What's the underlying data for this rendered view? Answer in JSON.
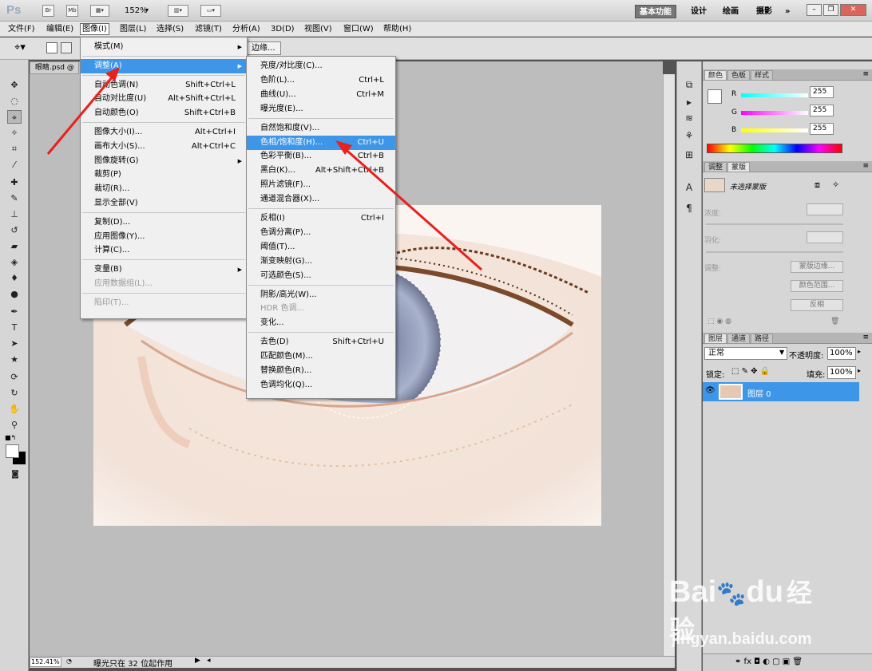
{
  "app": {
    "logo": "Ps",
    "zoom": "152%",
    "bridge": "Br",
    "mini_bridge": "Mb"
  },
  "workspaces": [
    "基本功能",
    "设计",
    "绘画",
    "摄影",
    "»"
  ],
  "menubar": [
    "文件(F)",
    "编辑(E)",
    "图像(I)",
    "图层(L)",
    "选择(S)",
    "滤镜(T)",
    "分析(A)",
    "3D(D)",
    "视图(V)",
    "窗口(W)",
    "帮助(H)"
  ],
  "options": {
    "refine_edge": "边缘..."
  },
  "document": {
    "tab": "眼睛.psd @"
  },
  "image_menu": [
    {
      "label": "模式(M)",
      "sc": "",
      "arrow": true
    },
    {
      "label": "调整(A)",
      "sc": "",
      "arrow": true,
      "hl": true
    },
    {
      "label": "自动色调(N)",
      "sc": "Shift+Ctrl+L"
    },
    {
      "label": "自动对比度(U)",
      "sc": "Alt+Shift+Ctrl+L"
    },
    {
      "label": "自动颜色(O)",
      "sc": "Shift+Ctrl+B"
    },
    {
      "label": "图像大小(I)...",
      "sc": "Alt+Ctrl+I"
    },
    {
      "label": "画布大小(S)...",
      "sc": "Alt+Ctrl+C"
    },
    {
      "label": "图像旋转(G)",
      "sc": "",
      "arrow": true
    },
    {
      "label": "裁剪(P)",
      "sc": ""
    },
    {
      "label": "裁切(R)...",
      "sc": ""
    },
    {
      "label": "显示全部(V)",
      "sc": ""
    },
    {
      "label": "复制(D)...",
      "sc": ""
    },
    {
      "label": "应用图像(Y)...",
      "sc": ""
    },
    {
      "label": "计算(C)...",
      "sc": ""
    },
    {
      "label": "变量(B)",
      "sc": "",
      "arrow": true
    },
    {
      "label": "应用数据组(L)...",
      "sc": "",
      "grey": true
    },
    {
      "label": "陷印(T)...",
      "sc": "",
      "grey": true
    }
  ],
  "adjust_menu": [
    {
      "label": "亮度/对比度(C)...",
      "sc": ""
    },
    {
      "label": "色阶(L)...",
      "sc": "Ctrl+L"
    },
    {
      "label": "曲线(U)...",
      "sc": "Ctrl+M"
    },
    {
      "label": "曝光度(E)...",
      "sc": ""
    },
    {
      "label": "自然饱和度(V)...",
      "sc": ""
    },
    {
      "label": "色相/饱和度(H)...",
      "sc": "Ctrl+U",
      "hl": true
    },
    {
      "label": "色彩平衡(B)...",
      "sc": "Ctrl+B"
    },
    {
      "label": "黑白(K)...",
      "sc": "Alt+Shift+Ctrl+B"
    },
    {
      "label": "照片滤镜(F)...",
      "sc": ""
    },
    {
      "label": "通道混合器(X)...",
      "sc": ""
    },
    {
      "label": "反相(I)",
      "sc": "Ctrl+I"
    },
    {
      "label": "色调分离(P)...",
      "sc": ""
    },
    {
      "label": "阈值(T)...",
      "sc": ""
    },
    {
      "label": "渐变映射(G)...",
      "sc": ""
    },
    {
      "label": "可选颜色(S)...",
      "sc": ""
    },
    {
      "label": "阴影/高光(W)...",
      "sc": ""
    },
    {
      "label": "HDR 色调...",
      "sc": "",
      "grey": true
    },
    {
      "label": "变化...",
      "sc": ""
    },
    {
      "label": "去色(D)",
      "sc": "Shift+Ctrl+U"
    },
    {
      "label": "匹配颜色(M)...",
      "sc": ""
    },
    {
      "label": "替换颜色(R)...",
      "sc": ""
    },
    {
      "label": "色调均化(Q)...",
      "sc": ""
    }
  ],
  "color_panel": {
    "tabs": [
      "颜色",
      "色板",
      "样式"
    ],
    "channels": [
      {
        "name": "R",
        "value": "255"
      },
      {
        "name": "G",
        "value": "255"
      },
      {
        "name": "B",
        "value": "255"
      }
    ]
  },
  "masks_panel": {
    "tabs": [
      "调整",
      "蒙版"
    ],
    "status": "未选择蒙版",
    "density": "浓度:",
    "feather": "羽化:",
    "refine": "调整:",
    "buttons": [
      "蒙版边缘...",
      "颜色范围...",
      "反相"
    ]
  },
  "layers_panel": {
    "tabs": [
      "图层",
      "通道",
      "路径"
    ],
    "blend_mode": "正常",
    "opacity_label": "不透明度:",
    "opacity": "100%",
    "lock_label": "锁定:",
    "fill_label": "填充:",
    "fill": "100%",
    "layers": [
      {
        "name": "图层 0",
        "selected": true
      }
    ]
  },
  "status": {
    "zoom": "152.41%",
    "info": "曝光只在 32 位起作用"
  },
  "watermark": {
    "brand": "Bai",
    "brand2": "du",
    "brand3": "经验",
    "url": "jingyan.baidu.com"
  },
  "colors": {
    "highlight": "#3d96e8",
    "annotation_red": "#e8201e"
  }
}
